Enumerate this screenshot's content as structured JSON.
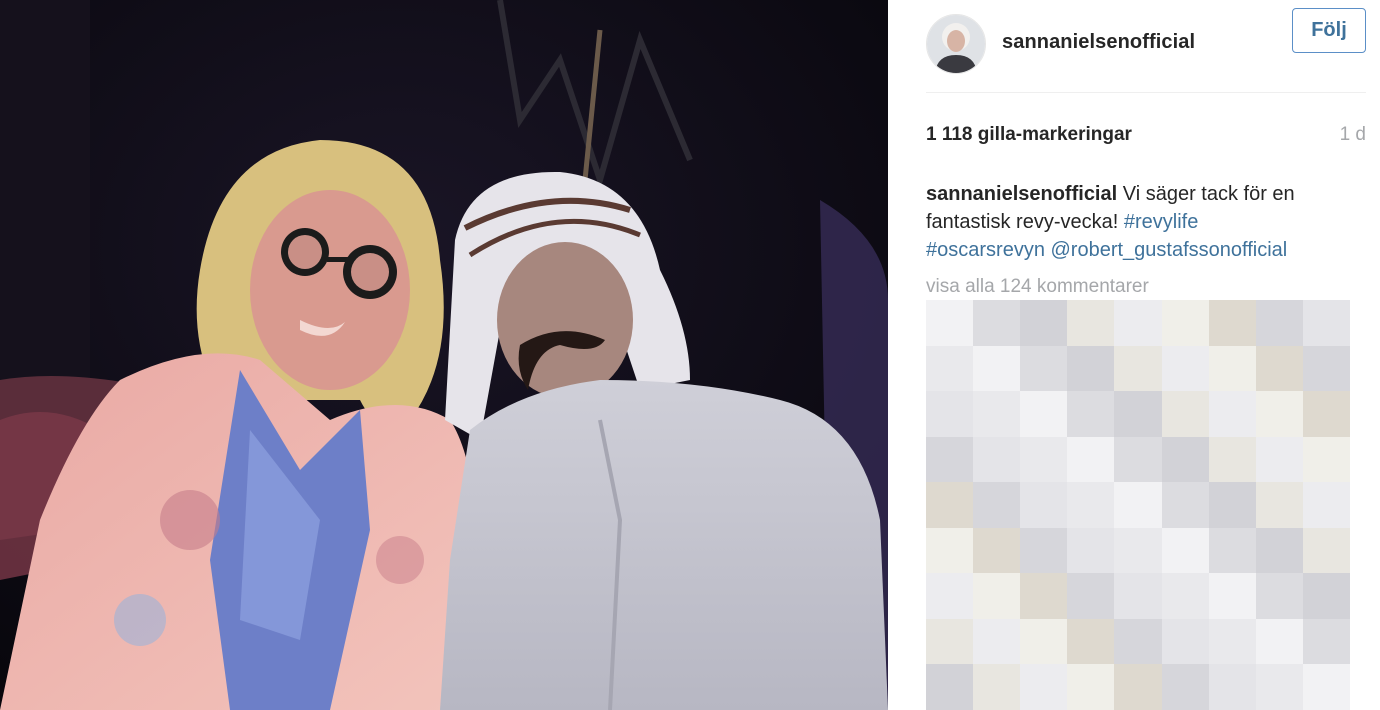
{
  "post": {
    "author": {
      "username": "sannanielsenofficial",
      "avatar_icon": "profile-photo"
    },
    "follow_label": "Följ",
    "likes_text": "1 118 gilla-markeringar",
    "age_text": "1 d",
    "caption": {
      "username": "sannanielsenofficial",
      "text_before": " Vi säger tack för en fantastisk revy-vecka! ",
      "hashtag_1": "#revylife",
      "hashtag_2": "#oscarsrevyn",
      "mention": "@robert_gustafssonofficial"
    },
    "view_all_comments": "visa alla 124 kommentarer"
  },
  "colors": {
    "link": "#3f729b",
    "muted": "#a5a7aa",
    "text": "#262626",
    "follow_border": "#5b8fc7"
  }
}
